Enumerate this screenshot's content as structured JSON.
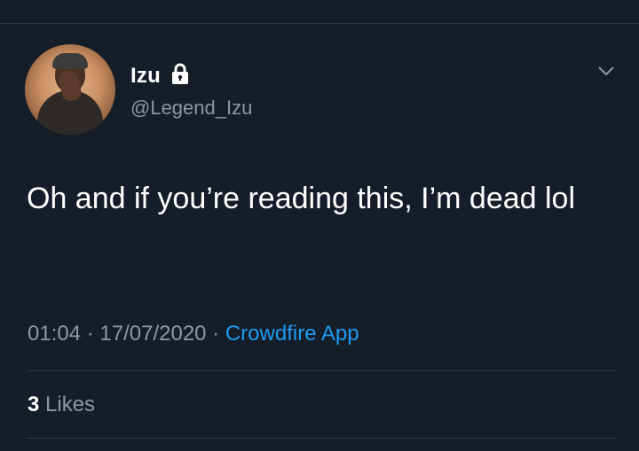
{
  "user": {
    "display_name": "Izu",
    "handle": "@Legend_Izu",
    "protected_icon": "lock-icon"
  },
  "tweet": {
    "text": "Oh and if you’re reading this, I’m dead lol",
    "time": "01:04",
    "separator": " · ",
    "date": "17/07/2020",
    "source": "Crowdfire App"
  },
  "stats": {
    "likes_count": "3",
    "likes_label": "Likes"
  },
  "menu": {
    "icon": "chevron-down-icon"
  },
  "colors": {
    "background": "#151d28",
    "muted_text": "#8b98a5",
    "link": "#1d9bf0",
    "divider": "#2f3944"
  }
}
